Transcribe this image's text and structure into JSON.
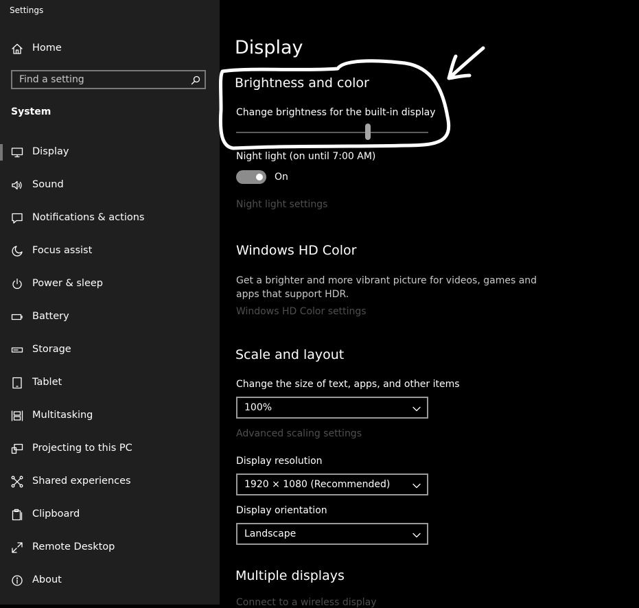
{
  "window": {
    "title": "Settings"
  },
  "sidebar": {
    "home_label": "Home",
    "search_placeholder": "Find a setting",
    "section_title": "System",
    "items": [
      {
        "label": "Display",
        "icon": "monitor-icon",
        "selected": true
      },
      {
        "label": "Sound",
        "icon": "speaker-icon"
      },
      {
        "label": "Notifications & actions",
        "icon": "notification-icon"
      },
      {
        "label": "Focus assist",
        "icon": "moon-icon"
      },
      {
        "label": "Power & sleep",
        "icon": "power-icon"
      },
      {
        "label": "Battery",
        "icon": "battery-icon"
      },
      {
        "label": "Storage",
        "icon": "storage-icon"
      },
      {
        "label": "Tablet",
        "icon": "tablet-icon"
      },
      {
        "label": "Multitasking",
        "icon": "multitasking-icon"
      },
      {
        "label": "Projecting to this PC",
        "icon": "projecting-icon"
      },
      {
        "label": "Shared experiences",
        "icon": "shared-icon"
      },
      {
        "label": "Clipboard",
        "icon": "clipboard-icon"
      },
      {
        "label": "Remote Desktop",
        "icon": "remote-desktop-icon"
      },
      {
        "label": "About",
        "icon": "info-icon"
      }
    ]
  },
  "main": {
    "title": "Display",
    "brightness": {
      "heading": "Brightness and color",
      "slider_label": "Change brightness for the built-in display",
      "slider_value": 0.69
    },
    "night_light": {
      "label": "Night light (on until 7:00 AM)",
      "state": "On",
      "settings_link": "Night light settings"
    },
    "hd_color": {
      "heading": "Windows HD Color",
      "description": "Get a brighter and more vibrant picture for videos, games and apps that support HDR.",
      "settings_link": "Windows HD Color settings"
    },
    "scale": {
      "heading": "Scale and layout",
      "size_label": "Change the size of text, apps, and other items",
      "size_value": "100%",
      "advanced_link": "Advanced scaling settings",
      "resolution_label": "Display resolution",
      "resolution_value": "1920 × 1080 (Recommended)",
      "orientation_label": "Display orientation",
      "orientation_value": "Landscape"
    },
    "multiple": {
      "heading": "Multiple displays",
      "connect_link": "Connect to a wireless display"
    }
  }
}
